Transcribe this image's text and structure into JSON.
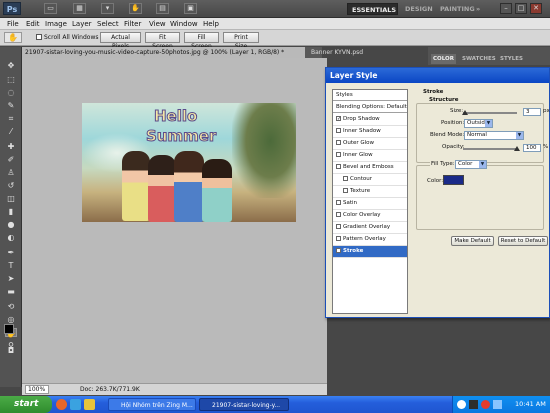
{
  "app": {
    "logo": "Ps",
    "workspaces": [
      "ESSENTIALS",
      "DESIGN",
      "PAINTING",
      "»"
    ]
  },
  "menu": [
    "File",
    "Edit",
    "Image",
    "Layer",
    "Select",
    "Filter",
    "View",
    "Window",
    "Help"
  ],
  "options": {
    "scroll_all_windows": "Scroll All Windows",
    "buttons": [
      "Actual Pixels",
      "Fit Screen",
      "Fill Screen",
      "Print Size"
    ]
  },
  "doc_tabs": [
    "21907-sistar-loving-you-music-video-capture-50photos.jpg @ 100% (Layer 1, RGB/8) *",
    "Banner KYVN.psd"
  ],
  "image_text": {
    "line1": "Hello",
    "line2": "Summer"
  },
  "status": {
    "zoom": "100%",
    "doc": "Doc: 263.7K/771.9K"
  },
  "panels": {
    "tabs": [
      "COLOR",
      "SWATCHES",
      "STYLES"
    ]
  },
  "dialog": {
    "title": "Layer Style",
    "styles_header": "Styles",
    "blending": "Blending Options: Default",
    "styles": [
      {
        "label": "Drop Shadow",
        "checked": true
      },
      {
        "label": "Inner Shadow",
        "checked": false
      },
      {
        "label": "Outer Glow",
        "checked": false
      },
      {
        "label": "Inner Glow",
        "checked": false
      },
      {
        "label": "Bevel and Emboss",
        "checked": false
      },
      {
        "label": "Contour",
        "checked": false
      },
      {
        "label": "Texture",
        "checked": false
      },
      {
        "label": "Satin",
        "checked": false
      },
      {
        "label": "Color Overlay",
        "checked": false
      },
      {
        "label": "Gradient Overlay",
        "checked": false
      },
      {
        "label": "Pattern Overlay",
        "checked": false
      },
      {
        "label": "Stroke",
        "checked": true
      }
    ],
    "stroke": {
      "section": "Stroke",
      "structure": "Structure",
      "size_label": "Size:",
      "size_value": "3",
      "size_unit": "px",
      "size_level": 0.03,
      "position_label": "Position:",
      "position_value": "Outside",
      "blend_label": "Blend Mode:",
      "blend_value": "Normal",
      "opacity_label": "Opacity:",
      "opacity_value": "100",
      "opacity_unit": "%",
      "opacity_level": 1.0,
      "fill_label": "Fill Type:",
      "fill_value": "Color",
      "color_label": "Color:",
      "color_hex": "#1a2a88"
    },
    "buttons": {
      "make_default": "Make Default",
      "reset": "Reset to Default"
    }
  },
  "taskbar": {
    "start": "start",
    "tasks": [
      "Hội Nhóm trên Zing M...",
      "21907-sistar-loving-y..."
    ],
    "clock": "10:41 AM"
  }
}
